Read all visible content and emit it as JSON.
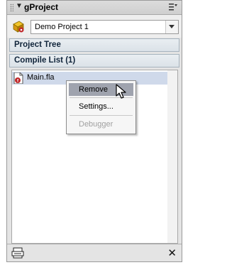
{
  "panel": {
    "title": "gProject",
    "collapse_glyph": "▼"
  },
  "project": {
    "selected": "Demo Project 1"
  },
  "sections": {
    "project_tree": "Project Tree",
    "compile_list": "Compile List (1)"
  },
  "files": [
    {
      "name": "Main.fla",
      "icon": "fla-file-icon"
    }
  ],
  "context_menu": {
    "items": [
      {
        "label": "Remove",
        "state": "hovered"
      },
      {
        "label": "Settings...",
        "state": "enabled"
      },
      {
        "label": "Debugger",
        "state": "disabled"
      }
    ]
  },
  "toolbar": {
    "compile_icon": "compile-icon",
    "close_glyph": "✕"
  },
  "colors": {
    "selection": "#cfd9ea",
    "menu_hover": "#9fa3ae",
    "section_border": "#a6b3be"
  }
}
